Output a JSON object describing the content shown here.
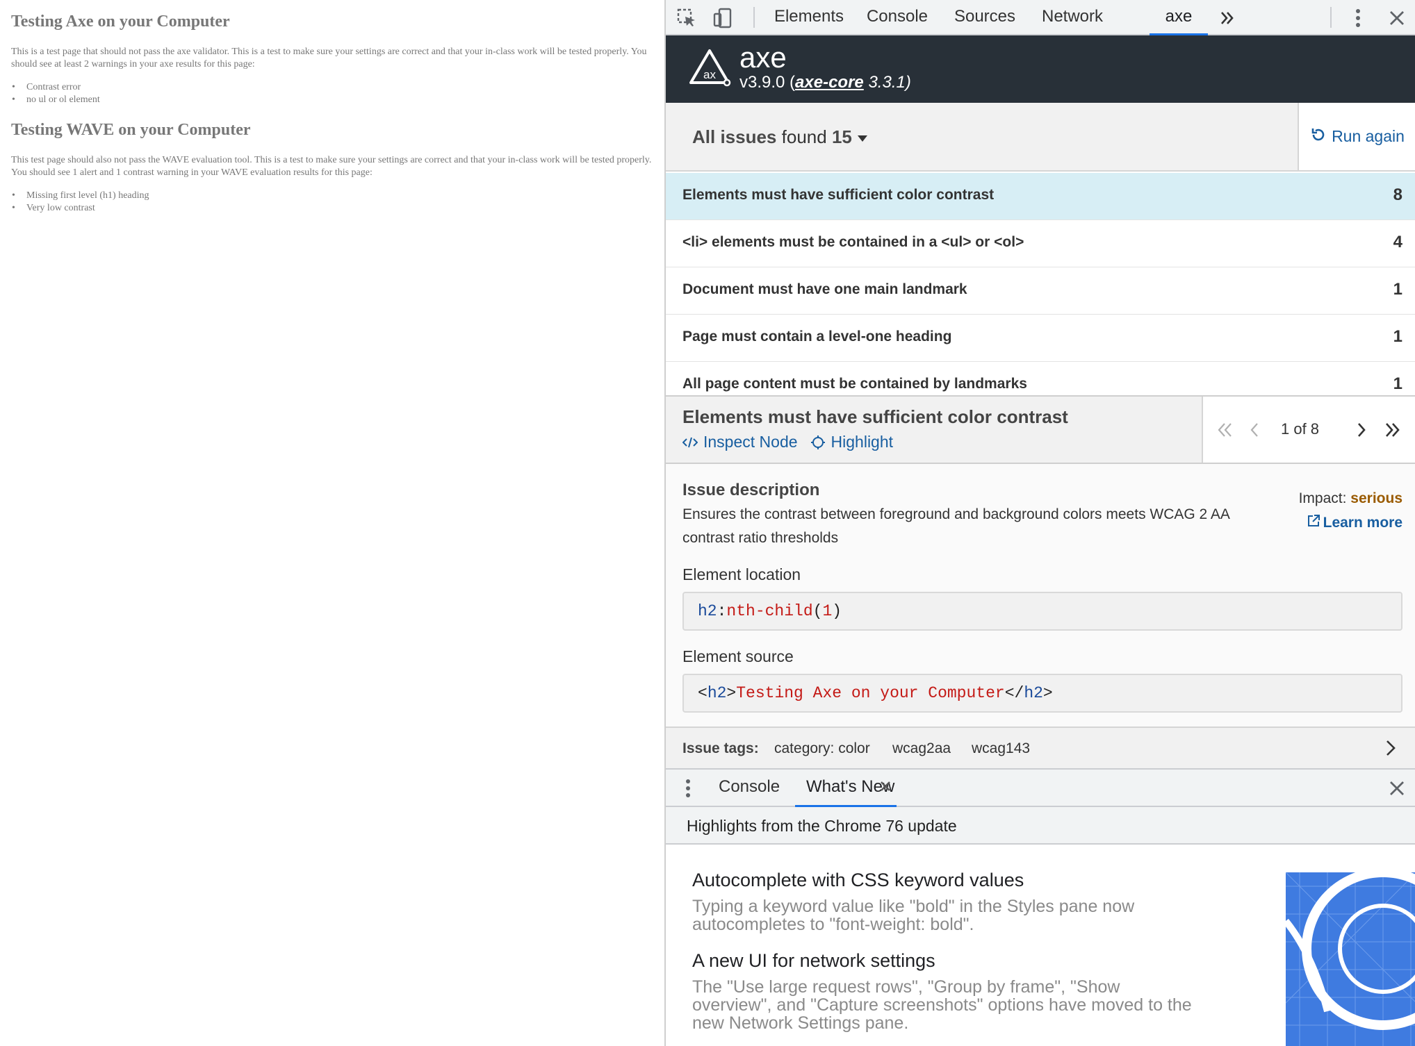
{
  "test_page": {
    "heading_axe": "Testing Axe on your Computer",
    "para_axe": "This is a test page that should not pass the axe validator. This is a test to make sure your settings are correct and that your in-class work will be tested properly. You should see at least 2 warnings in your axe results for this page:",
    "list_axe": [
      "Contrast error",
      "no ul or ol element"
    ],
    "heading_wave": "Testing WAVE on your Computer",
    "para_wave": "This test page should also not pass the WAVE evaluation tool. This is a test to make sure your settings are correct and that your in-class work will be tested properly. You should see 1 alert and 1 contrast warning in your WAVE evaluation results for this page:",
    "list_wave": [
      "Missing first level (h1) heading",
      "Very low contrast"
    ]
  },
  "devtools": {
    "tabs": [
      "Elements",
      "Console",
      "Sources",
      "Network",
      "axe"
    ],
    "active_tab": "axe",
    "toolbar_icons": [
      "inspect-element-icon",
      "device-toolbar-icon",
      "more-tabs-icon",
      "kebab-menu-icon",
      "close-icon"
    ]
  },
  "axe": {
    "name": "axe",
    "version_prefix": "v3.9.0 (",
    "core_link": "axe-core",
    "core_version": " 3.3.1)",
    "issues_label": "All issues",
    "found_label": "found",
    "issues_count": "15",
    "run_again": "Run again",
    "issues": [
      {
        "label": "Elements must have sufficient color contrast",
        "count": "8",
        "selected": true
      },
      {
        "label": "<li> elements must be contained in a <ul> or <ol>",
        "count": "4",
        "selected": false
      },
      {
        "label": "Document must have one main landmark",
        "count": "1",
        "selected": false
      },
      {
        "label": "Page must contain a level-one heading",
        "count": "1",
        "selected": false
      },
      {
        "label": "All page content must be contained by landmarks",
        "count": "1",
        "selected": false
      }
    ],
    "detail": {
      "title": "Elements must have sufficient color contrast",
      "inspect_node": "Inspect Node",
      "highlight": "Highlight",
      "pager": "1 of 8",
      "desc_heading": "Issue description",
      "desc_text": "Ensures the contrast between foreground and background colors meets WCAG 2 AA contrast ratio thresholds",
      "impact_label": "Impact:",
      "impact_value": "serious",
      "learn_more": "Learn more",
      "location_label": "Element location",
      "location_selector": {
        "tag": "h2",
        "colon": ":",
        "pseudo": "nth-child",
        "open": "(",
        "arg": "1",
        "close": ")"
      },
      "source_label": "Element source",
      "source": {
        "lt": "<",
        "tag": "h2",
        "gt": ">",
        "text": "Testing Axe on your Computer",
        "close_lt": "</",
        "close_tag": "h2",
        "close_gt": ">"
      },
      "tags_label": "Issue tags:",
      "tags": [
        "category: color",
        "wcag2aa",
        "wcag143"
      ]
    }
  },
  "drawer": {
    "tabs": [
      "Console",
      "What's New"
    ],
    "active_tab": "What's New",
    "title": "Highlights from the Chrome 76 update",
    "items": [
      {
        "heading": "Autocomplete with CSS keyword values",
        "text": "Typing a keyword value like \"bold\" in the Styles pane now autocompletes to \"font-weight: bold\"."
      },
      {
        "heading": "A new UI for network settings",
        "text": "The \"Use large request rows\", \"Group by frame\", \"Show overview\", and \"Capture screenshots\" options have moved to the new Network Settings pane."
      }
    ]
  },
  "colors": {
    "axe_header_bg": "#283038",
    "selected_row_bg": "#d7eef5",
    "link_blue": "#185ea0",
    "impact_serious": "#9a5b00",
    "active_tab_underline": "#1a73e8",
    "test_page_text": "#777777"
  }
}
